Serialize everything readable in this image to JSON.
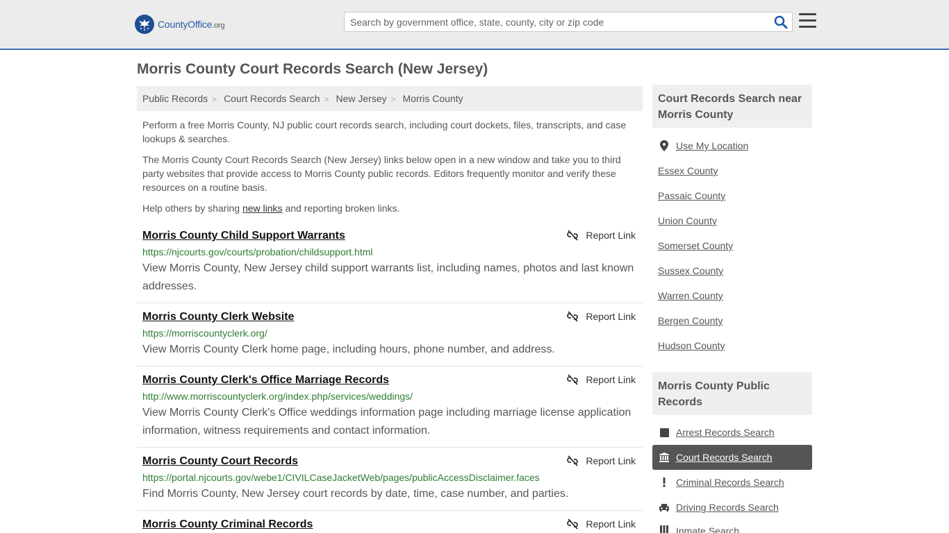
{
  "header": {
    "logo_main": "CountyOffice",
    "logo_suffix": ".org",
    "search_placeholder": "Search by government office, state, county, city or zip code"
  },
  "page_title": "Morris County Court Records Search (New Jersey)",
  "breadcrumb": [
    "Public Records",
    "Court Records Search",
    "New Jersey",
    "Morris County"
  ],
  "intro": {
    "p1": "Perform a free Morris County, NJ public court records search, including court dockets, files, transcripts, and case lookups & searches.",
    "p2": "The Morris County Court Records Search (New Jersey) links below open in a new window and take you to third party websites that provide access to Morris County public records. Editors frequently monitor and verify these resources on a routine basis.",
    "p3_before": "Help others by sharing ",
    "p3_link": "new links",
    "p3_after": " and reporting broken links."
  },
  "report_label": "Report Link",
  "results": [
    {
      "title": "Morris County Child Support Warrants",
      "url": "https://njcourts.gov/courts/probation/childsupport.html",
      "desc": "View Morris County, New Jersey child support warrants list, including names, photos and last known addresses."
    },
    {
      "title": "Morris County Clerk Website",
      "url": "https://morriscountyclerk.org/",
      "desc": "View Morris County Clerk home page, including hours, phone number, and address."
    },
    {
      "title": "Morris County Clerk's Office Marriage Records",
      "url": "http://www.morriscountyclerk.org/index.php/services/weddings/",
      "desc": "View Morris County Clerk's Office weddings information page including marriage license application information, witness requirements and contact information."
    },
    {
      "title": "Morris County Court Records",
      "url": "https://portal.njcourts.gov/webe1/CIVILCaseJacketWeb/pages/publicAccessDisclaimer.faces",
      "desc": "Find Morris County, New Jersey court records by date, time, case number, and parties."
    },
    {
      "title": "Morris County Criminal Records",
      "url": "",
      "desc": ""
    }
  ],
  "sidebar": {
    "nearby_heading": "Court Records Search near Morris County",
    "use_location": "Use My Location",
    "nearby": [
      "Essex County",
      "Passaic County",
      "Union County",
      "Somerset County",
      "Sussex County",
      "Warren County",
      "Bergen County",
      "Hudson County"
    ],
    "public_heading": "Morris County Public Records",
    "public_items": [
      {
        "label": "Arrest Records Search",
        "icon": "square-icon"
      },
      {
        "label": "Court Records Search",
        "icon": "courthouse-icon"
      },
      {
        "label": "Criminal Records Search",
        "icon": "exclamation-icon"
      },
      {
        "label": "Driving Records Search",
        "icon": "car-icon"
      },
      {
        "label": "Inmate Search",
        "icon": "inmate-icon"
      }
    ]
  },
  "colors": {
    "accent_border": "#3b6fb6",
    "url_green": "#2e7d32",
    "active_item_bg": "#555555"
  }
}
